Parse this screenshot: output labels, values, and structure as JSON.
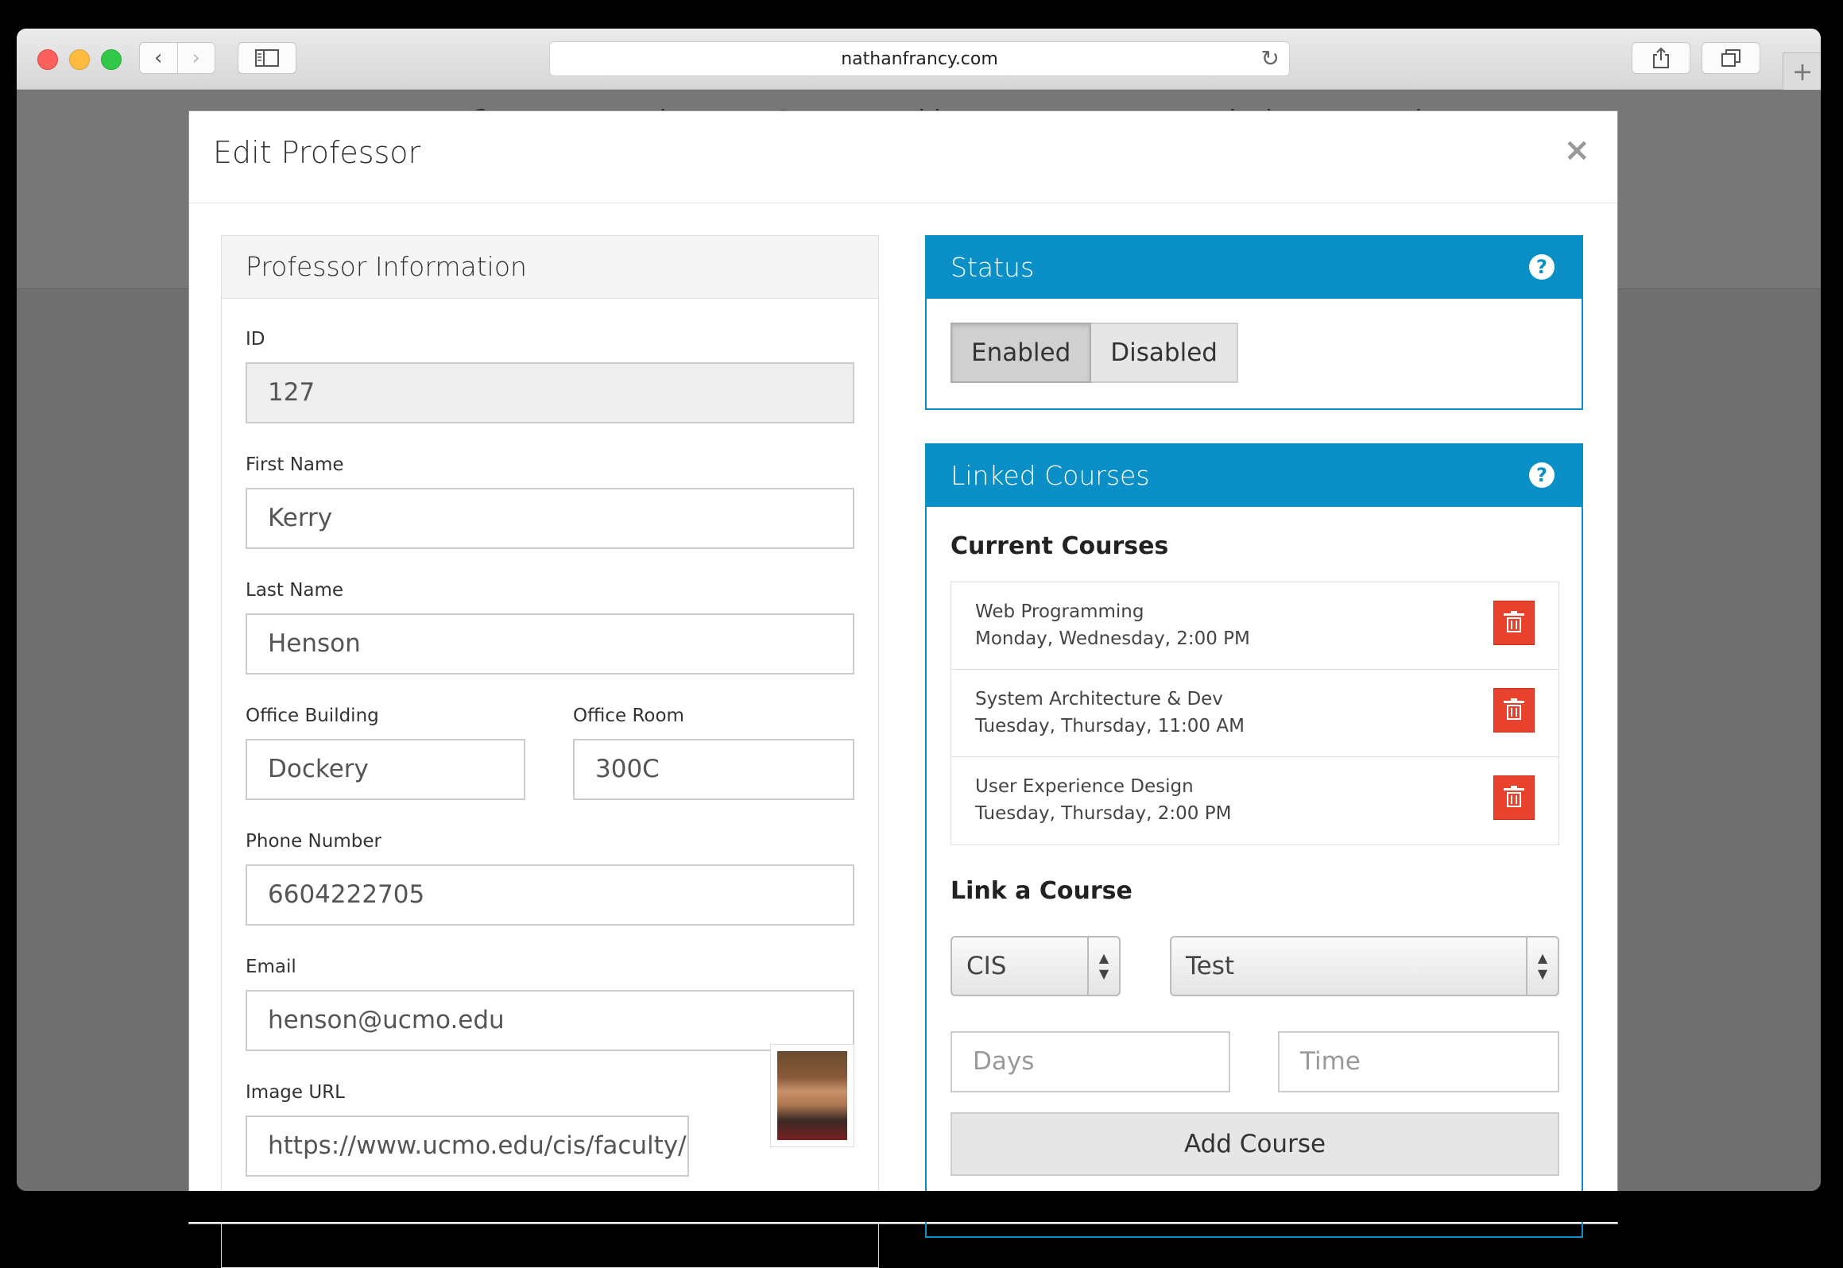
{
  "browser": {
    "url": "nathanfrancy.com",
    "back_glyph": "‹",
    "forward_glyph": "›",
    "reload_glyph": "↻",
    "new_tab_glyph": "+"
  },
  "page": {
    "title": "Information Coordinator Dashboard"
  },
  "modal": {
    "title": "Edit Professor",
    "close_glyph": "×"
  },
  "professor_info": {
    "heading": "Professor Information",
    "id_label": "ID",
    "id_value": "127",
    "first_name_label": "First Name",
    "first_name_value": "Kerry",
    "last_name_label": "Last Name",
    "last_name_value": "Henson",
    "office_building_label": "Office Building",
    "office_building_value": "Dockery",
    "office_room_label": "Office Room",
    "office_room_value": "300C",
    "phone_label": "Phone Number",
    "phone_value": "6604222705",
    "email_label": "Email",
    "email_value": "henson@ucmo.edu",
    "image_url_label": "Image URL",
    "image_url_value": "https://www.ucmo.edu/cis/faculty/im"
  },
  "status": {
    "heading": "Status",
    "help_glyph": "?",
    "options": [
      "Enabled",
      "Disabled"
    ],
    "selected": "Enabled"
  },
  "linked_courses": {
    "heading": "Linked Courses",
    "help_glyph": "?",
    "current_title": "Current Courses",
    "courses": [
      {
        "name": "Web Programming",
        "schedule": "Monday, Wednesday, 2:00 PM"
      },
      {
        "name": "System Architecture & Dev",
        "schedule": "Tuesday, Thursday, 11:00 AM"
      },
      {
        "name": "User Experience Design",
        "schedule": "Tuesday, Thursday, 2:00 PM"
      }
    ],
    "link_title": "Link a Course",
    "department_select": "CIS",
    "course_select": "Test",
    "days_placeholder": "Days",
    "time_placeholder": "Time",
    "add_button": "Add Course"
  },
  "colors": {
    "accent": "#0a8fc6",
    "danger": "#e8412c"
  }
}
